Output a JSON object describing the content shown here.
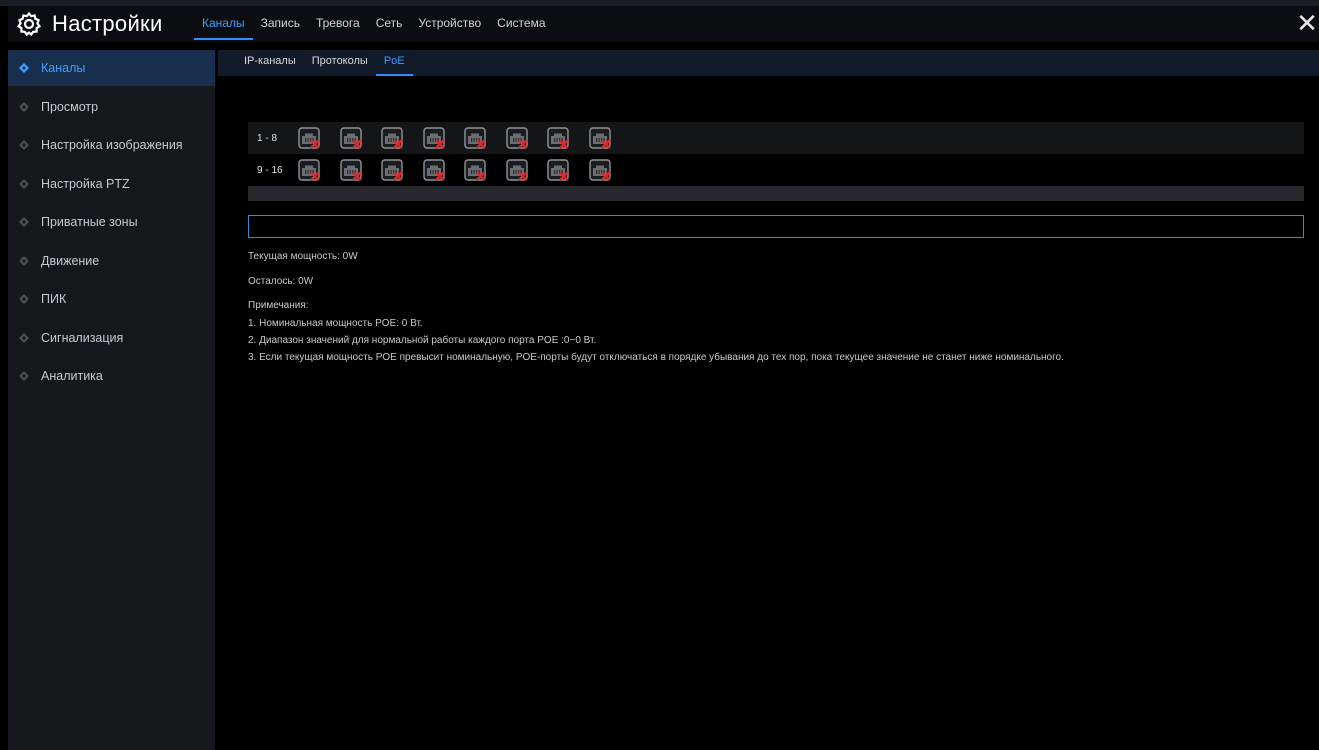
{
  "header": {
    "title": "Настройки",
    "tabs": [
      {
        "label": "Каналы",
        "active": true
      },
      {
        "label": "Запись",
        "active": false
      },
      {
        "label": "Тревога",
        "active": false
      },
      {
        "label": "Сеть",
        "active": false
      },
      {
        "label": "Устройство",
        "active": false
      },
      {
        "label": "Система",
        "active": false
      }
    ],
    "close_icon": "close-icon"
  },
  "sidebar": {
    "items": [
      {
        "label": "Каналы",
        "active": true
      },
      {
        "label": "Просмотр",
        "active": false
      },
      {
        "label": "Настройка изображения",
        "active": false
      },
      {
        "label": "Настройка PTZ",
        "active": false
      },
      {
        "label": "Приватные зоны",
        "active": false
      },
      {
        "label": "Движение",
        "active": false
      },
      {
        "label": "ПИК",
        "active": false
      },
      {
        "label": "Сигнализация",
        "active": false
      },
      {
        "label": "Аналитика",
        "active": false
      }
    ]
  },
  "subtabs": [
    {
      "label": "IP-каналы",
      "active": false
    },
    {
      "label": "Протоколы",
      "active": false
    },
    {
      "label": "PoE",
      "active": true
    }
  ],
  "poe": {
    "rows": [
      {
        "label": "1 - 8",
        "ports": 8,
        "status": "disconnected"
      },
      {
        "label": "9 - 16",
        "ports": 8,
        "status": "disconnected"
      }
    ],
    "input_value": "",
    "current_power": "Текущая мощность: 0W",
    "remaining": "Осталось: 0W",
    "notes_title": "Примечания:",
    "notes": [
      "1. Номинальная мощность POE: 0 Вт.",
      "2. Диапазон значений для нормальной работы каждого порта POE :0~0 Вт.",
      "3. Если текущая мощность POE превысит номинальную, POE-порты будут отключаться в порядке убывания до тех пор, пока текущее значение не станет ниже номинального."
    ]
  },
  "colors": {
    "accent": "#2f8cff",
    "sidebar_bg": "#15171b",
    "sidebar_active_bg": "#172f4d",
    "port_x": "#e5232a"
  }
}
